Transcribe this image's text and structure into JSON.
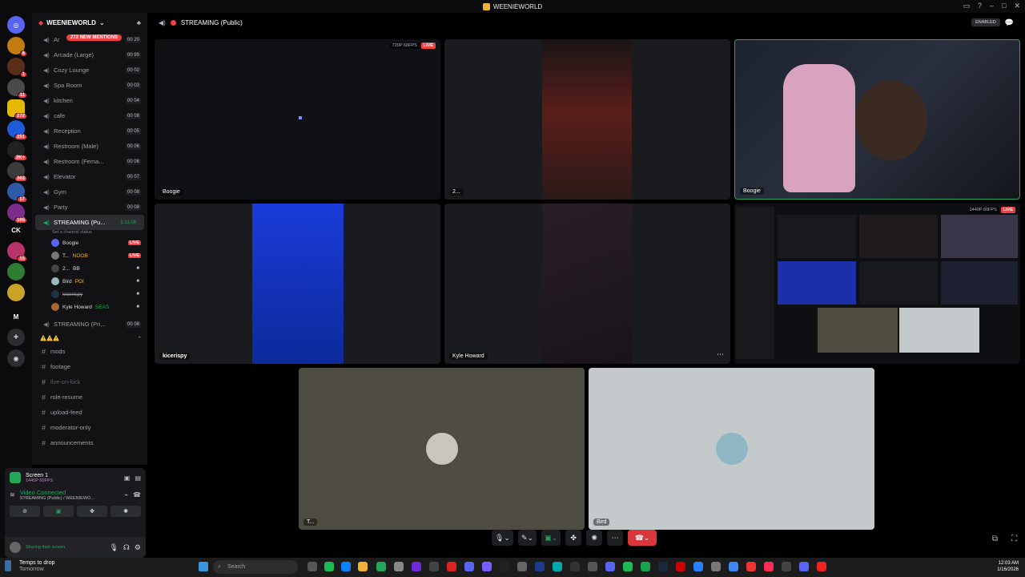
{
  "titlebar": {
    "title": "WEENIEWORLD"
  },
  "server_rail": {
    "items": [
      {
        "badge": "6"
      },
      {
        "badge": "1"
      },
      {
        "badge": "11"
      },
      {
        "badge": "272"
      },
      {
        "badge": "251"
      },
      {
        "badge": "2K+"
      },
      {
        "badge": "363"
      },
      {
        "badge": "17"
      },
      {
        "badge": "165"
      },
      {
        "label": "CK"
      },
      {
        "badge": "15"
      },
      {
        "badge": ""
      },
      {
        "badge": ""
      },
      {
        "label": "M"
      }
    ]
  },
  "guild": {
    "name": "WEENIEWORLD",
    "new_mentions": "272 NEW MENTIONS"
  },
  "voice_channels": [
    {
      "name": "Ar",
      "count": "00 20"
    },
    {
      "name": "Arcade (Large)",
      "count": "00 99"
    },
    {
      "name": "Cozy Lounge",
      "count": "00 02"
    },
    {
      "name": "Spa Room",
      "count": "00 03"
    },
    {
      "name": "kitchen",
      "count": "00 04"
    },
    {
      "name": "cafe",
      "count": "00 08"
    },
    {
      "name": "Reception",
      "count": "00 05"
    },
    {
      "name": "Restroom (Male)",
      "count": "00 06"
    },
    {
      "name": "Restroom (Fema...",
      "count": "00 06"
    },
    {
      "name": "Elevator",
      "count": "00 07"
    },
    {
      "name": "Gym",
      "count": "00 08"
    },
    {
      "name": "Party",
      "count": "00 08"
    }
  ],
  "active_channel": {
    "name": "STREAMING (Pu...",
    "timer": "1:11:09",
    "status": "Set a channel status"
  },
  "voice_users": [
    {
      "name": "Boogie",
      "tag": "LIVE"
    },
    {
      "name": "T...",
      "extra": "NOOB",
      "tag": "LIVE"
    },
    {
      "name": "2...",
      "extra": "BB",
      "tag": ""
    },
    {
      "name": "Bird",
      "extra": "POI",
      "tag": ""
    },
    {
      "name": "kicerispy",
      "extra": "",
      "tag": ""
    },
    {
      "name": "Kyle Howard",
      "extra": "SEAS",
      "tag": ""
    }
  ],
  "other_channel": {
    "name": "STREAMING (Pri...",
    "count": "00 08"
  },
  "category": {
    "name": "⚠️⚠️⚠️"
  },
  "text_channels": [
    {
      "name": "mods"
    },
    {
      "name": "footage"
    },
    {
      "name": "live-on-kick"
    },
    {
      "name": "role-resume"
    },
    {
      "name": "upload-feed"
    },
    {
      "name": "moderator-only"
    },
    {
      "name": "announcements"
    }
  ],
  "rtc": {
    "screen_title": "Screen 1",
    "screen_quality": "1440P 60FPS",
    "status": "Video Connected",
    "channel": "STREAMING (Public) / WEENIEWO...",
    "user_status": "Sharing their screen"
  },
  "main": {
    "channel_title": "STREAMING (Public)",
    "enabled": "ENABLED",
    "tiles": [
      {
        "label": "Boogie",
        "quality": "720P 60FPS",
        "live": "LIVE"
      },
      {
        "label": "2..."
      },
      {
        "label": "Boogie"
      },
      {
        "label": "kicerispy"
      },
      {
        "label": "Kyle Howard"
      },
      {
        "label": "",
        "quality": "1440P 60FPS",
        "live": "LIVE"
      },
      {
        "label": "T..."
      },
      {
        "label": "Bird"
      }
    ]
  },
  "taskbar": {
    "weather": "Temps to drop",
    "weather_sub": "Tomorrow",
    "search_placeholder": "Search",
    "time": "12:03 AM",
    "date": "1/16/2026"
  },
  "colors": {
    "accent_green": "#23a55a",
    "live_red": "#f23f43",
    "blurple": "#5865f2"
  }
}
